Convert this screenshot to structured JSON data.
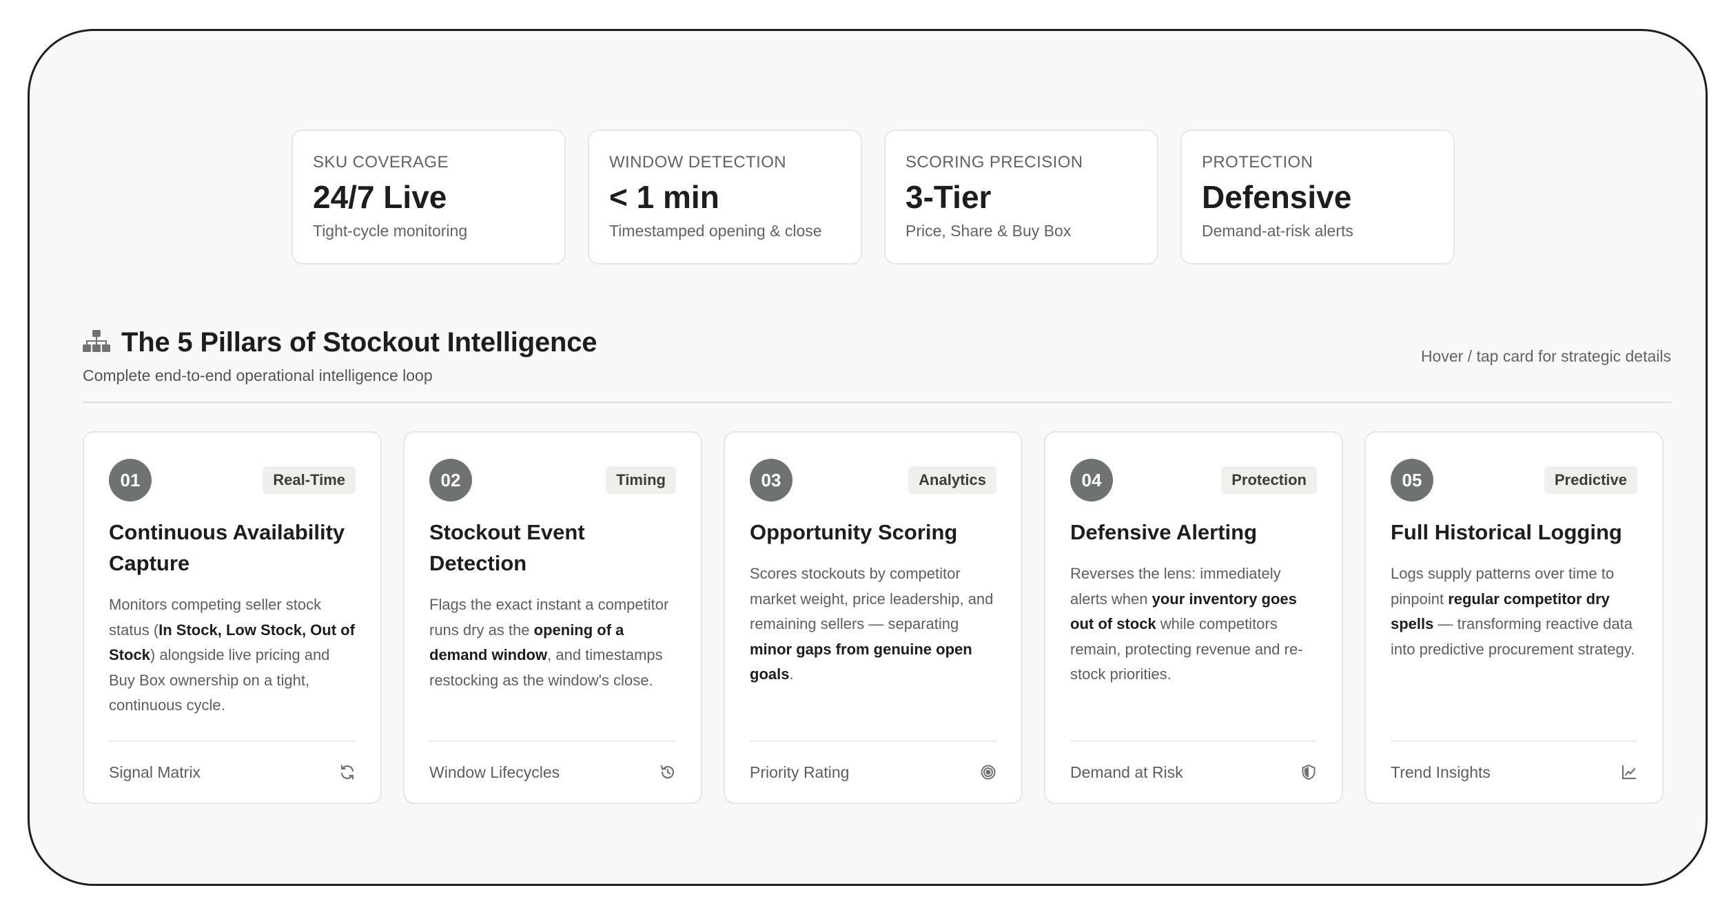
{
  "stats": [
    {
      "label": "SKU COVERAGE",
      "value": "24/7 Live",
      "sub": "Tight-cycle monitoring"
    },
    {
      "label": "WINDOW DETECTION",
      "value": "< 1 min",
      "sub": "Timestamped opening & close"
    },
    {
      "label": "SCORING PRECISION",
      "value": "3-Tier",
      "sub": "Price, Share & Buy Box"
    },
    {
      "label": "PROTECTION",
      "value": "Defensive",
      "sub": "Demand-at-risk alerts"
    }
  ],
  "section": {
    "icon": "hierarchy-icon",
    "title": "The 5 Pillars of Stockout Intelligence",
    "subtitle": "Complete end-to-end operational intelligence loop",
    "hint": "Hover / tap card for strategic details"
  },
  "pillars": [
    {
      "num": "01",
      "tag": "Real-Time",
      "title": "Continuous Availability Capture",
      "desc": [
        {
          "t": "Monitors competing seller stock status (",
          "b": false
        },
        {
          "t": "In Stock, Low Stock, Out of Stock",
          "b": true
        },
        {
          "t": ") alongside live pricing and Buy Box ownership on a tight, continuous cycle.",
          "b": false
        }
      ],
      "foot": "Signal Matrix",
      "icon": "refresh-icon"
    },
    {
      "num": "02",
      "tag": "Timing",
      "title": "Stockout Event Detection",
      "desc": [
        {
          "t": "Flags the exact instant a competitor runs dry as the ",
          "b": false
        },
        {
          "t": "opening of a demand window",
          "b": true
        },
        {
          "t": ", and timestamps restocking as the window's close.",
          "b": false
        }
      ],
      "foot": "Window Lifecycles",
      "icon": "history-icon"
    },
    {
      "num": "03",
      "tag": "Analytics",
      "title": "Opportunity Scoring",
      "desc": [
        {
          "t": "Scores stockouts by competitor market weight, price leadership, and remaining sellers — separating ",
          "b": false
        },
        {
          "t": "minor gaps from genuine open goals",
          "b": true
        },
        {
          "t": ".",
          "b": false
        }
      ],
      "foot": "Priority Rating",
      "icon": "target-icon"
    },
    {
      "num": "04",
      "tag": "Protection",
      "title": "Defensive Alerting",
      "desc": [
        {
          "t": "Reverses the lens: immediately alerts when ",
          "b": false
        },
        {
          "t": "your inventory goes out of stock",
          "b": true
        },
        {
          "t": " while competitors remain, protecting revenue and re-stock priorities.",
          "b": false
        }
      ],
      "foot": "Demand at Risk",
      "icon": "shield-icon"
    },
    {
      "num": "05",
      "tag": "Predictive",
      "title": "Full Historical Logging",
      "desc": [
        {
          "t": "Logs supply patterns over time to pinpoint ",
          "b": false
        },
        {
          "t": "regular competitor dry spells",
          "b": true
        },
        {
          "t": " — transforming reactive data into predictive procurement strategy.",
          "b": false
        }
      ],
      "foot": "Trend Insights",
      "icon": "trend-chart-icon"
    }
  ]
}
